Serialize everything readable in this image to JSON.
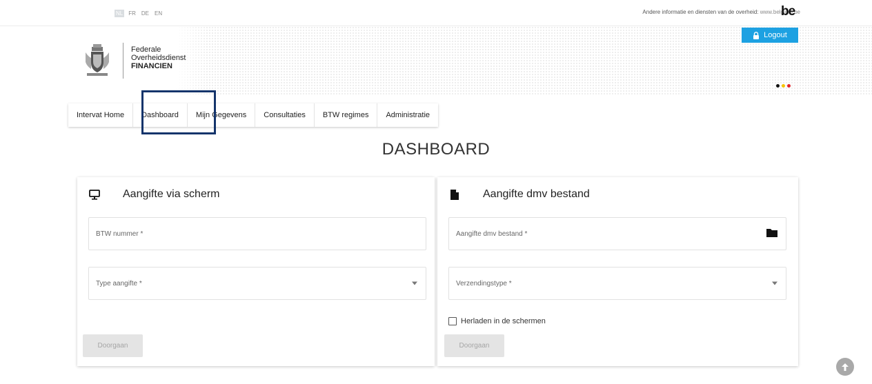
{
  "languages": [
    "NL",
    "FR",
    "DE",
    "EN"
  ],
  "active_language": "NL",
  "gov_info": {
    "text": "Andere informatie en diensten van de overheid:",
    "url": "www.belgium.be",
    "logo": "be"
  },
  "logo": {
    "line1": "Federale",
    "line2": "Overheidsdienst",
    "line3": "FINANCIEN"
  },
  "logout_label": "Logout",
  "flag_colors": [
    "#111111",
    "#f5c400",
    "#e2242b"
  ],
  "nav": {
    "tabs": [
      {
        "label": "Intervat Home"
      },
      {
        "label": "Dashboard"
      },
      {
        "label": "Mijn Gegevens"
      },
      {
        "label": "Consultaties"
      },
      {
        "label": "BTW regimes"
      },
      {
        "label": "Administratie"
      }
    ],
    "active": "Dashboard"
  },
  "page_title": "DASHBOARD",
  "left_card": {
    "icon": "monitor-icon",
    "title": "Aangifte via scherm",
    "fields": {
      "btw_placeholder": "BTW nummer *",
      "type_placeholder": "Type aangifte *"
    },
    "button_label": "Doorgaan"
  },
  "right_card": {
    "icon": "file-icon",
    "title": "Aangifte dmv bestand",
    "fields": {
      "file_placeholder": "Aangifte dmv bestand *",
      "type_placeholder": "Verzendingstype *"
    },
    "checkbox_label": "Herladen in de schermen",
    "button_label": "Doorgaan"
  },
  "colors": {
    "accent": "#1da1e2",
    "highlight_border": "#14346b",
    "disabled_button": "#e4e4e4"
  }
}
